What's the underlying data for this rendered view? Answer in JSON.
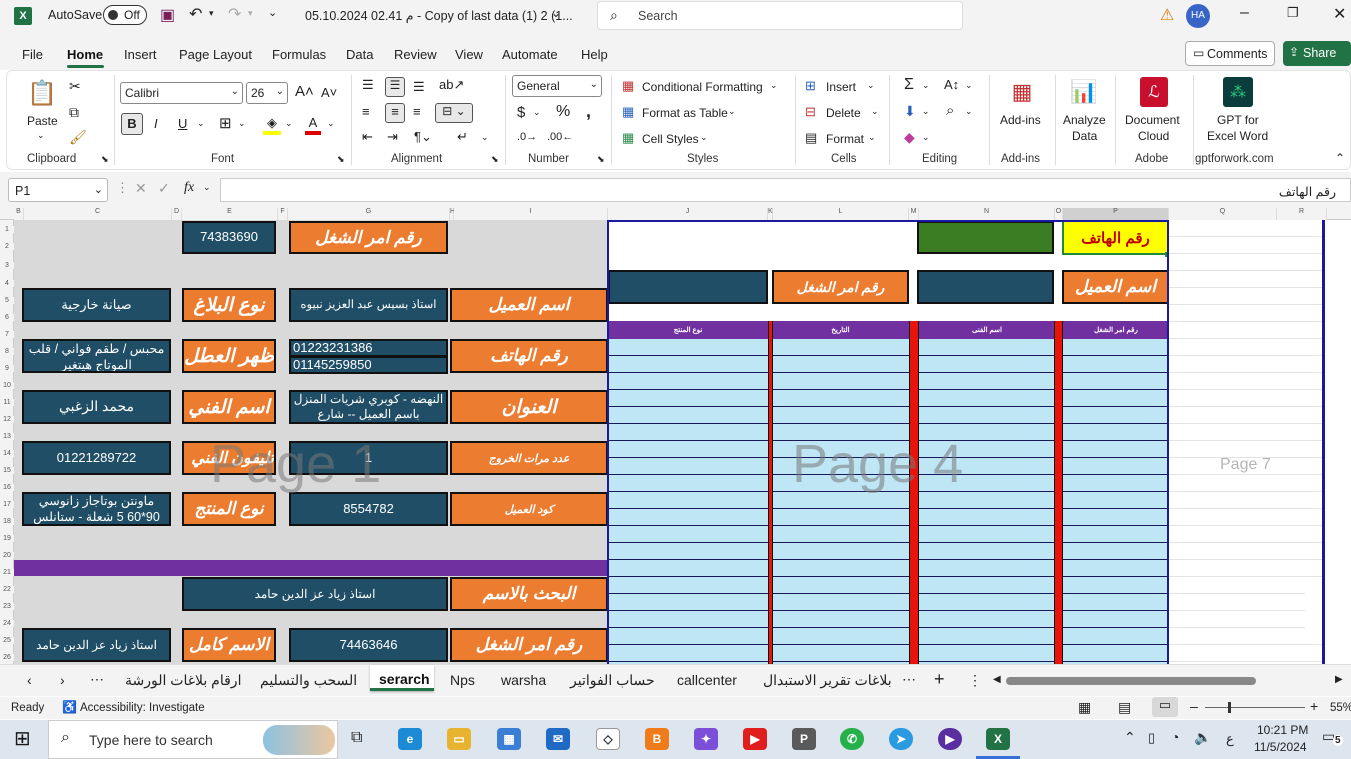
{
  "title_bar": {
    "autosave_label": "AutoSave",
    "autosave_state": "Off",
    "file_name": "05.10.2024 02.41 م - Copy of last data (1) 2 (1...",
    "search_placeholder": "Search",
    "user_initials": "HA"
  },
  "menu": {
    "items": [
      "File",
      "Home",
      "Insert",
      "Page Layout",
      "Formulas",
      "Data",
      "Review",
      "View",
      "Automate",
      "Help"
    ],
    "active": "Home",
    "comments_label": "Comments",
    "share_label": "Share"
  },
  "ribbon": {
    "clipboard": {
      "paste": "Paste",
      "label": "Clipboard"
    },
    "font": {
      "name": "Calibri",
      "size": "26",
      "label": "Font"
    },
    "alignment": {
      "label": "Alignment"
    },
    "number": {
      "format": "General",
      "label": "Number"
    },
    "styles": {
      "conditional": "Conditional Formatting",
      "format_table": "Format as Table",
      "cell_styles": "Cell Styles",
      "label": "Styles"
    },
    "cells": {
      "insert": "Insert",
      "delete": "Delete",
      "format": "Format",
      "label": "Cells"
    },
    "editing": {
      "label": "Editing"
    },
    "addins": {
      "button": "Add-ins",
      "label": "Add-ins"
    },
    "analyze": {
      "line1": "Analyze",
      "line2": "Data"
    },
    "document_cloud": {
      "line1": "Document",
      "line2": "Cloud",
      "label": "Adobe"
    },
    "gpt": {
      "line1": "GPT for",
      "line2": "Excel Word",
      "label": "gptforwork.com"
    }
  },
  "formula_bar": {
    "name_box": "P1",
    "fx": "fx",
    "content": "رقم الهاتف"
  },
  "columns": [
    "B",
    "C",
    "D",
    "E",
    "F",
    "G",
    "H",
    "I",
    "J",
    "K",
    "L",
    "M",
    "N",
    "O",
    "P",
    "Q",
    "R"
  ],
  "rows": [
    "1",
    "2",
    "3",
    "4",
    "5",
    "6",
    "7",
    "8",
    "9",
    "10",
    "11",
    "12",
    "13",
    "14",
    "15",
    "16",
    "17",
    "18",
    "19",
    "20",
    "21",
    "22",
    "23",
    "24",
    "25",
    "26"
  ],
  "page1": {
    "order_no_value": "74383690",
    "order_no_label": "رقم امر الشغل",
    "customer_label": "اسم العميل",
    "customer_value": "استاذ بسيس عبد العزيز نبيوه",
    "report_type_label": "نوع البلاغ",
    "report_type_value": "صيانة خارجية",
    "phone_label": "رقم الهاتف",
    "phone_value_1": "01223231386",
    "phone_value_2": "01145259850",
    "fault_label": "ظهر العطل",
    "fault_value": "محبس / طقم فواني / قلب الموتاج هيتغير",
    "address_label": "العنوان",
    "address_value": "النهضه - كوبري شريات المنزل باسم العميل -- شارع",
    "tech_label": "اسم الفني",
    "tech_value": "محمد الزغبي",
    "exits_label": "عدد مرات الخروج",
    "exits_value": "1",
    "tech_phone_label": "تليفون الفني",
    "tech_phone_value": "01221289722",
    "customer_code_label": "كود العميل",
    "customer_code_value": "8554782",
    "product_label": "نوع المنتج",
    "product_value": "ماونتن بوتاجاز زانوسي 90*60 5 شعلة - ستانلس",
    "search_name_label": "البحث بالاسم",
    "search_name_value": "استاذ زياد عز الدين حامد",
    "full_name_label": "الاسم كامل",
    "full_name_value": "استاذ زياد عز الدين حامد",
    "order_no2_label": "رقم امر الشغل",
    "order_no2_value": "74463646"
  },
  "page4": {
    "phone_header": "رقم الهاتف",
    "customer_header": "اسم العميل",
    "order_header": "رقم امر الشغل",
    "table_headers": [
      "نوع المنتج",
      "التاريخ",
      "اسم الفنى",
      "رقم امر الشغل"
    ]
  },
  "watermarks": [
    "Page 1",
    "Page 4",
    "Page 7"
  ],
  "sheet_tabs": [
    "ارقام بلاغات الورشة",
    "السحب والتسليم",
    "serarch",
    "Nps",
    "warsha",
    "حساب الفواتير",
    "callcenter",
    "بلاغات تقرير الاستبدال"
  ],
  "active_tab": "serarch",
  "status": {
    "ready": "Ready",
    "accessibility": "Accessibility: Investigate",
    "zoom": "55%"
  },
  "taskbar": {
    "search_placeholder": "Type here to search",
    "time": "10:21 PM",
    "date": "11/5/2024",
    "lang": "ع",
    "notifications": "5"
  },
  "colors": {
    "navy": "#1f4e66",
    "orange": "#ec7c30",
    "green_header": "#3a7d22",
    "yellow_header": "#ffff00",
    "purple_band": "#7030a0",
    "light_blue": "#bfe6f5",
    "excel_green": "#217346"
  }
}
